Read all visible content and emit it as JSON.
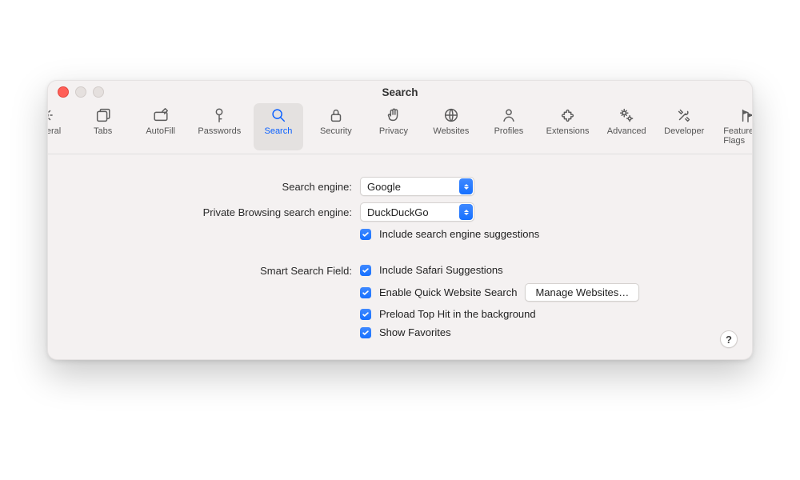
{
  "window": {
    "title": "Search"
  },
  "tabs": {
    "general": {
      "label": "General"
    },
    "tabs": {
      "label": "Tabs"
    },
    "autofill": {
      "label": "AutoFill"
    },
    "passwords": {
      "label": "Passwords"
    },
    "search": {
      "label": "Search"
    },
    "security": {
      "label": "Security"
    },
    "privacy": {
      "label": "Privacy"
    },
    "websites": {
      "label": "Websites"
    },
    "profiles": {
      "label": "Profiles"
    },
    "extensions": {
      "label": "Extensions"
    },
    "advanced": {
      "label": "Advanced"
    },
    "developer": {
      "label": "Developer"
    },
    "feature": {
      "label": "Feature Flags"
    }
  },
  "labels": {
    "search_engine": "Search engine:",
    "private_engine": "Private Browsing search engine:",
    "smart_field": "Smart Search Field:"
  },
  "selects": {
    "search_engine_value": "Google",
    "private_engine_value": "DuckDuckGo"
  },
  "checks": {
    "include_engine_suggestions": "Include search engine suggestions",
    "include_safari_suggestions": "Include Safari Suggestions",
    "enable_quick_website_search": "Enable Quick Website Search",
    "preload_top_hit": "Preload Top Hit in the background",
    "show_favorites": "Show Favorites"
  },
  "buttons": {
    "manage_websites": "Manage Websites…"
  },
  "help": "?"
}
